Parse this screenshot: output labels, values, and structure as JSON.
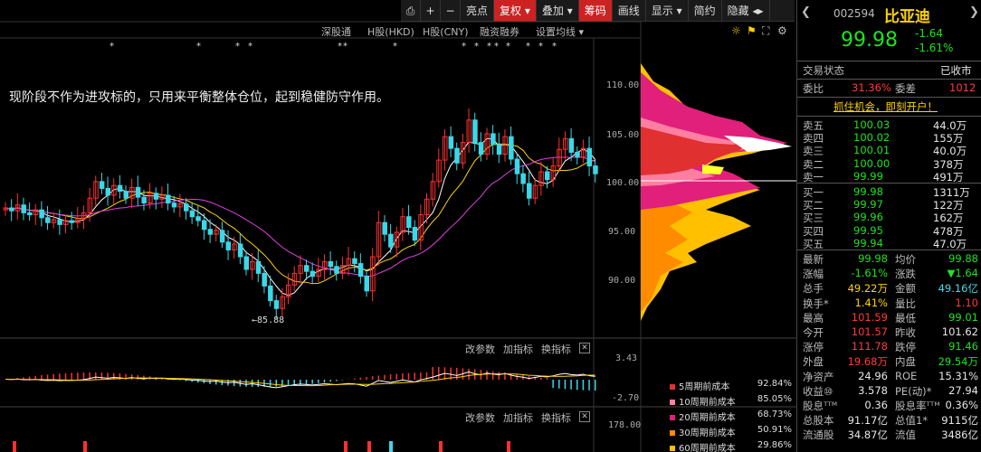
{
  "toolbar": {
    "items": [
      "亮点",
      "复权",
      "叠加",
      "筹码",
      "画线",
      "显示",
      "简约",
      "隐藏"
    ],
    "active_index": 1,
    "highlight_index": 3
  },
  "tabs": {
    "shenggutong": "深股通",
    "h_hkd": "H股(HKD)",
    "h_cny": "H股(CNY)",
    "margin": "融资融券",
    "ma_setting": "设置均线"
  },
  "notice": "现阶段不作为进攻标的，只用来平衡整体仓位，起到稳健防守作用。",
  "price_axis": [
    "110.00",
    "105.00",
    "100.00",
    "95.00",
    "90.00"
  ],
  "low_marker": "85.88",
  "indicator1": {
    "edit": "改参数",
    "add": "加指标",
    "switch": "换指标",
    "close": "✕",
    "top": "3.43",
    "bottom": "-2.70"
  },
  "indicator2": {
    "edit": "改参数",
    "add": "加指标",
    "switch": "换指标",
    "close": "✕",
    "top": "178.00"
  },
  "cost_legend": [
    {
      "label": "5周期前成本",
      "pct": "92.84%",
      "color": "#e03030"
    },
    {
      "label": "10周期前成本",
      "pct": "85.05%",
      "color": "#ff7fa0"
    },
    {
      "label": "20周期前成本",
      "pct": "68.73%",
      "color": "#e0207a"
    },
    {
      "label": "30周期前成本",
      "pct": "50.91%",
      "color": "#ff8c00"
    },
    {
      "label": "60周期前成本",
      "pct": "29.86%",
      "color": "#ffc000"
    }
  ],
  "stock": {
    "code": "002594",
    "name": "比亚迪",
    "price": "99.98",
    "change": "-1.64",
    "change_pct": "-1.61%",
    "trade_status_label": "交易状态",
    "trade_status": "已收市",
    "webi_label": "委比",
    "webi": "31.36%",
    "weicha_label": "委差",
    "weicha": "1012",
    "promo": "抓住机会，即刻开户！"
  },
  "asks": [
    {
      "label": "卖五",
      "price": "100.03",
      "vol": "44.0万"
    },
    {
      "label": "卖四",
      "price": "100.02",
      "vol": "155万"
    },
    {
      "label": "卖三",
      "price": "100.01",
      "vol": "40.0万"
    },
    {
      "label": "卖二",
      "price": "100.00",
      "vol": "378万"
    },
    {
      "label": "卖一",
      "price": "99.99",
      "vol": "491万"
    }
  ],
  "bids": [
    {
      "label": "买一",
      "price": "99.98",
      "vol": "1311万"
    },
    {
      "label": "买二",
      "price": "99.97",
      "vol": "122万"
    },
    {
      "label": "买三",
      "price": "99.96",
      "vol": "162万"
    },
    {
      "label": "买四",
      "price": "99.95",
      "vol": "478万"
    },
    {
      "label": "买五",
      "price": "99.94",
      "vol": "47.0万"
    }
  ],
  "stats": [
    {
      "l1": "最新",
      "v1": "99.98",
      "c1": "green",
      "l2": "均价",
      "v2": "99.88",
      "c2": "green"
    },
    {
      "l1": "涨幅",
      "v1": "-1.61%",
      "c1": "green",
      "l2": "涨跌",
      "v2": "▼1.64",
      "c2": "green"
    },
    {
      "l1": "总手",
      "v1": "49.22万",
      "c1": "yellow",
      "l2": "金额",
      "v2": "49.16亿",
      "c2": "cyan"
    },
    {
      "l1": "换手*",
      "v1": "1.41%",
      "c1": "yellow",
      "l2": "量比",
      "v2": "1.10",
      "c2": "red"
    },
    {
      "l1": "最高",
      "v1": "101.59",
      "c1": "red",
      "l2": "最低",
      "v2": "99.01",
      "c2": "green"
    },
    {
      "l1": "今开",
      "v1": "101.57",
      "c1": "red",
      "l2": "昨收",
      "v2": "101.62",
      "c2": "white"
    },
    {
      "l1": "涨停",
      "v1": "111.78",
      "c1": "red",
      "l2": "跌停",
      "v2": "91.46",
      "c2": "green"
    },
    {
      "l1": "外盘",
      "v1": "19.68万",
      "c1": "red",
      "l2": "内盘",
      "v2": "29.54万",
      "c2": "green"
    },
    {
      "l1": "净资产",
      "v1": "24.96",
      "c1": "white",
      "l2": "ROE",
      "v2": "15.31%",
      "c2": "white"
    },
    {
      "l1": "收益⑩",
      "v1": "3.578",
      "c1": "white",
      "l2": "PE(动)*",
      "v2": "27.94",
      "c2": "white"
    },
    {
      "l1": "股息ᵀᵀᴹ",
      "v1": "0.36",
      "c1": "white",
      "l2": "股息率ᵀᵀᴹ",
      "v2": "0.36%",
      "c2": "white"
    },
    {
      "l1": "总股本",
      "v1": "91.17亿",
      "c1": "white",
      "l2": "总值1*",
      "v2": "9115亿",
      "c2": "white"
    },
    {
      "l1": "流通股",
      "v1": "34.87亿",
      "c1": "white",
      "l2": "流值",
      "v2": "3486亿",
      "c2": "white"
    }
  ]
}
